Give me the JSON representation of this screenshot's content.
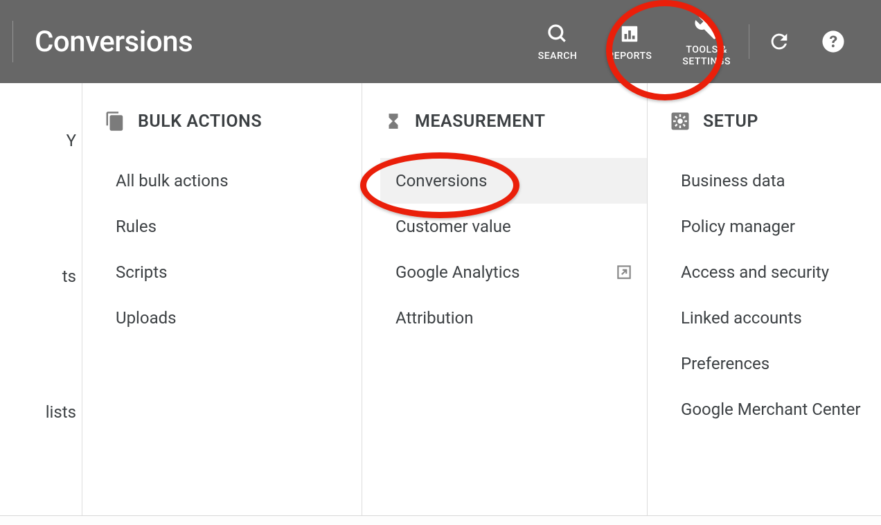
{
  "header": {
    "title": "Conversions",
    "actions": {
      "search": "SEARCH",
      "reports": "REPORTS",
      "tools": "TOOLS &\nSETTINGS"
    }
  },
  "cols": {
    "partial": {
      "items": [
        "Y",
        "ts",
        "lists"
      ]
    },
    "bulk": {
      "heading": "BULK ACTIONS",
      "items": [
        "All bulk actions",
        "Rules",
        "Scripts",
        "Uploads"
      ]
    },
    "measurement": {
      "heading": "MEASUREMENT",
      "items": [
        "Conversions",
        "Customer value",
        "Google Analytics",
        "Attribution"
      ]
    },
    "setup": {
      "heading": "SETUP",
      "items": [
        "Business data",
        "Policy manager",
        "Access and security",
        "Linked accounts",
        "Preferences",
        "Google Merchant Center"
      ]
    }
  }
}
